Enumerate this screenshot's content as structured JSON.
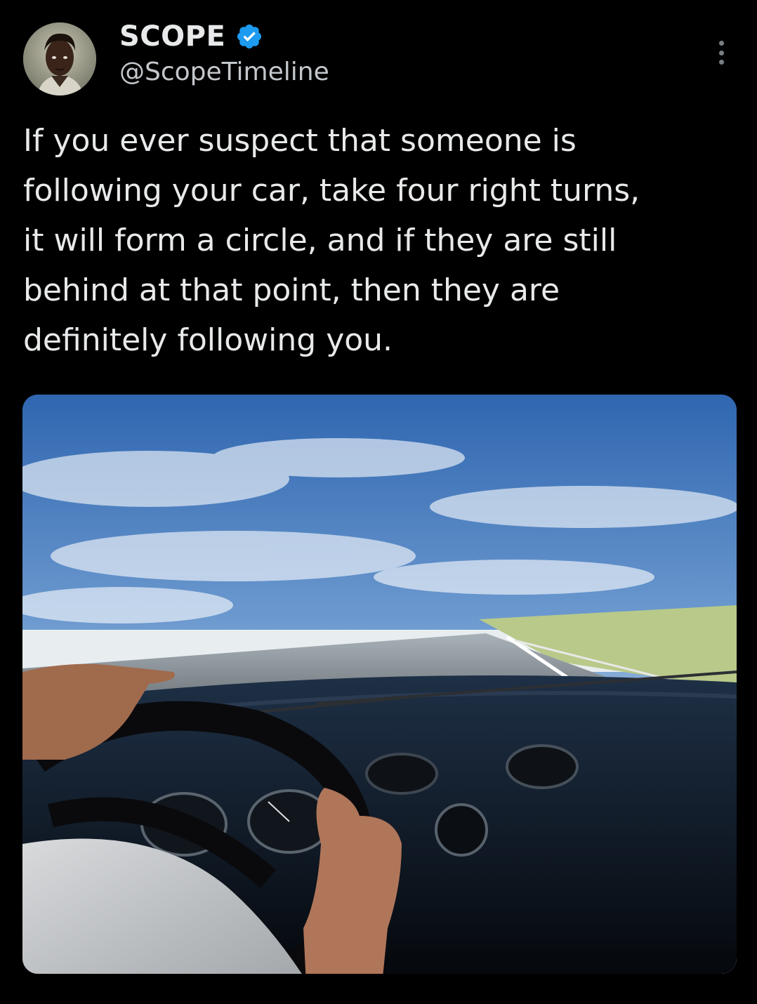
{
  "tweet": {
    "display_name": "SCOPE",
    "handle": "@ScopeTimeline",
    "text": "If you ever suspect that someone is\nfollowing your car, take four right turns,\nit will form a circle, and if they are still\nbehind at that point, then they are\ndefinitely following you.",
    "avatar_icon": "profile-photo",
    "verified_icon": "verified-badge-icon",
    "more_icon": "more-options-icon",
    "media_description_icon": "car-driving-photo"
  },
  "colors": {
    "background": "#000000",
    "text_primary": "#e7e9ea",
    "text_secondary": "#c3c7cb",
    "verified_blue": "#1d9bf0"
  }
}
